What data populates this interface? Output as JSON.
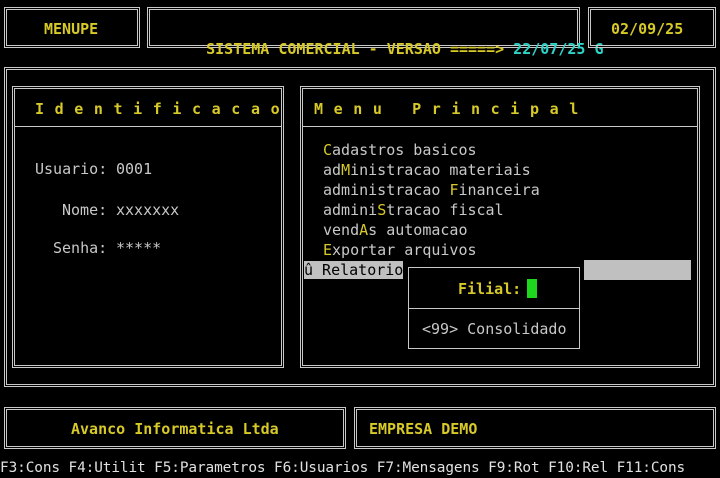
{
  "header": {
    "program": "MENUPE",
    "system_title": "SISTEMA COMERCIAL - VERSAO =====>",
    "version": "22/07/25 G",
    "date": "02/09/25"
  },
  "identification": {
    "title": "Identificacao",
    "user_label": "Usuario:",
    "user_value": "0001",
    "name_label": "Nome:",
    "name_value": "xxxxxxx",
    "password_label": "Senha:",
    "password_value": "*****"
  },
  "menu": {
    "title": "Menu Principal",
    "items": [
      {
        "pre": "",
        "hot": "C",
        "post": "adastros basicos"
      },
      {
        "pre": "ad",
        "hot": "M",
        "post": "inistracao materiais"
      },
      {
        "pre": "administracao ",
        "hot": "F",
        "post": "inanceira"
      },
      {
        "pre": "admini",
        "hot": "S",
        "post": "tracao fiscal"
      },
      {
        "pre": "vend",
        "hot": "A",
        "post": "s automacao"
      },
      {
        "pre": "",
        "hot": "E",
        "post": "xportar arquivos"
      },
      {
        "pre": "û Relatorio",
        "hot": "",
        "post": ""
      }
    ]
  },
  "filial_popup": {
    "label": "Filial:",
    "option": "<99> Consolidado"
  },
  "footer": {
    "company_left": "Avanco Informatica Ltda",
    "company_right": "EMPRESA DEMO"
  },
  "function_keys": "F3:Cons F4:Utilit F5:Parametros F6:Usuarios F7:Mensagens F9:Rot F10:Rel F11:Cons"
}
